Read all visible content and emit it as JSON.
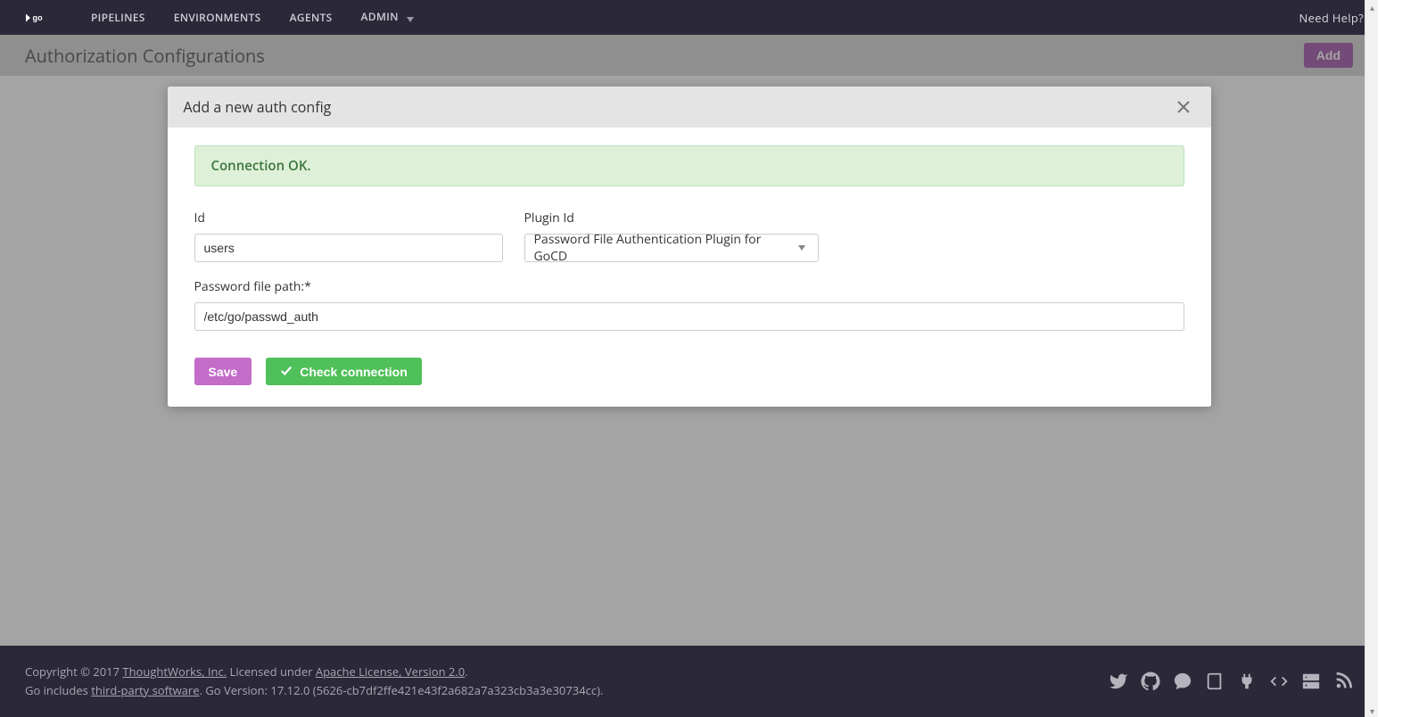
{
  "nav": {
    "pipelines": "PIPELINES",
    "environments": "ENVIRONMENTS",
    "agents": "AGENTS",
    "admin": "ADMIN",
    "need_help": "Need Help?"
  },
  "page": {
    "title": "Authorization Configurations",
    "add_label": "Add"
  },
  "modal": {
    "title": "Add a new auth config",
    "alert": "Connection OK.",
    "id_label": "Id",
    "id_value": "users",
    "plugin_label": "Plugin Id",
    "plugin_value": "Password File Authentication Plugin for GoCD",
    "path_label": "Password file path:*",
    "path_value": "/etc/go/passwd_auth",
    "save_label": "Save",
    "check_label": "Check connection"
  },
  "footer": {
    "copyright_prefix": "Copyright © 2017 ",
    "thoughtworks": "ThoughtWorks, Inc.",
    "licensed": " Licensed under ",
    "apache": "Apache License, Version 2.0",
    "period1": ".",
    "line2_prefix": "Go includes ",
    "thirdparty": "third-party software",
    "version_suffix": ". Go Version: 17.12.0 (5626-cb7df2ffe421e43f2a682a7a323cb3a3e30734cc)."
  }
}
